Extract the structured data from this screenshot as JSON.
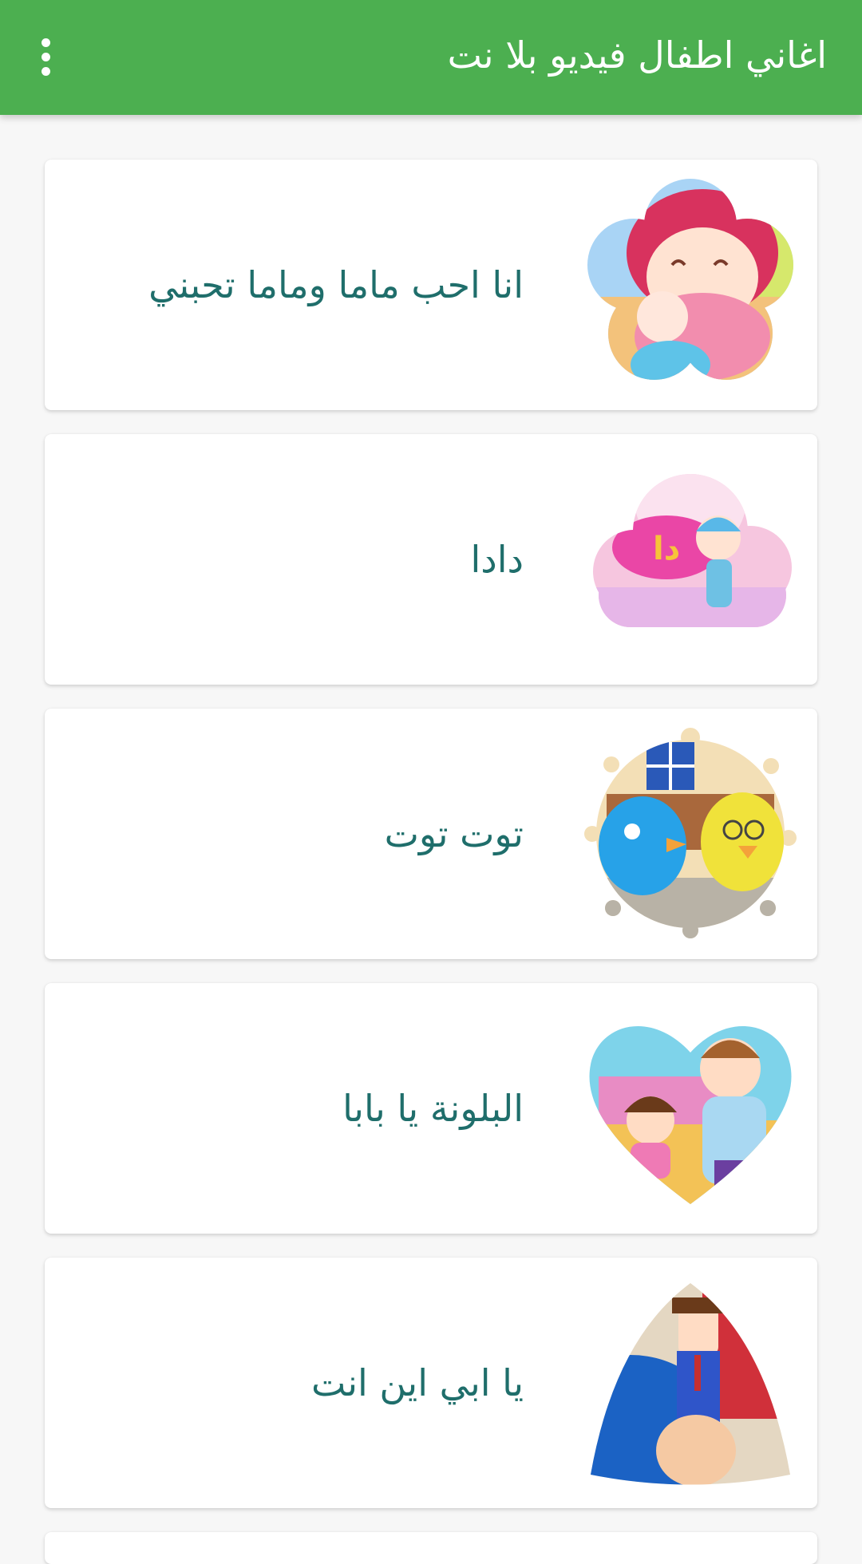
{
  "app_bar": {
    "title": "اغاني اطفال فيديو بلا نت",
    "menu_icon": "more-vert-icon"
  },
  "colors": {
    "primary": "#4caf50",
    "card_text": "#1f6e6b",
    "background": "#f7f7f7"
  },
  "songs": [
    {
      "title": "انا احب ماما وماما تحبني",
      "thumbnail": "flower-shaped-cartoon-girl-with-baby"
    },
    {
      "title": "دادا",
      "thumbnail": "cloud-shaped-cartoon-dada-logo"
    },
    {
      "title": "توت توت",
      "thumbnail": "splash-shaped-cartoon-birds-on-bench"
    },
    {
      "title": "البلونة يا بابا",
      "thumbnail": "heart-shaped-cartoon-father-and-daughter"
    },
    {
      "title": "يا ابي اين انت",
      "thumbnail": "triangle-shaped-finger-puppet"
    }
  ]
}
